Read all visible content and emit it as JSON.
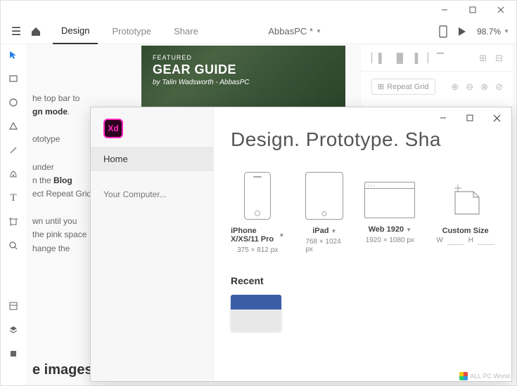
{
  "main_window": {
    "tabs": {
      "design": "Design",
      "prototype": "Prototype",
      "share": "Share"
    },
    "project_name": "AbbasPC *",
    "zoom": "98.7%"
  },
  "sidebar_help": {
    "line1a": "he top bar to",
    "line1b": "gn mode",
    "line2": "ototype",
    "line3a": "under",
    "line3b": "n the",
    "line3c": "Blog",
    "line3d": "ect Repeat Grid",
    "line4a": "wn until you",
    "line4b": "the pink space",
    "line4c": "hange the"
  },
  "hero": {
    "featured": "FEATURED",
    "title": "GEAR GUIDE",
    "byline": "by Talin Wadsworth - AbbasPC"
  },
  "right_panel": {
    "repeat_grid": "Repeat Grid"
  },
  "heading_images": "e images",
  "welcome": {
    "home": "Home",
    "your_computer": "Your Computer...",
    "heading": "Design. Prototype. Sha",
    "presets": [
      {
        "name": "iPhone X/XS/11 Pro",
        "dims": "375 × 812 px"
      },
      {
        "name": "iPad",
        "dims": "768 × 1024 px"
      },
      {
        "name": "Web 1920",
        "dims": "1920 × 1080 px"
      },
      {
        "name": "Custom Size",
        "w": "W",
        "h": "H"
      }
    ],
    "recent": "Recent"
  },
  "watermark": "ALL PC World"
}
